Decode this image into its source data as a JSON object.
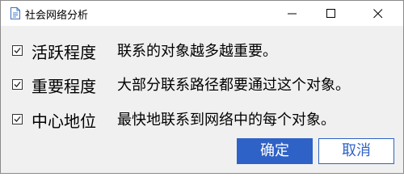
{
  "window": {
    "title": "社会网络分析",
    "icon": "document-icon"
  },
  "titlebar_buttons": {
    "minimize_icon": "minimize-icon",
    "maximize_icon": "maximize-icon",
    "close_icon": "close-icon"
  },
  "options": [
    {
      "checked": true,
      "label": "活跃程度",
      "description": "联系的对象越多越重要。"
    },
    {
      "checked": true,
      "label": "重要程度",
      "description": "大部分联系路径都要通过这个对象。"
    },
    {
      "checked": true,
      "label": "中心地位",
      "description": "最快地联系到网络中的每个对象。"
    }
  ],
  "buttons": {
    "ok_label": "确定",
    "cancel_label": "取消"
  },
  "colors": {
    "accent": "#2f62c6",
    "background": "#f0f0f0"
  }
}
